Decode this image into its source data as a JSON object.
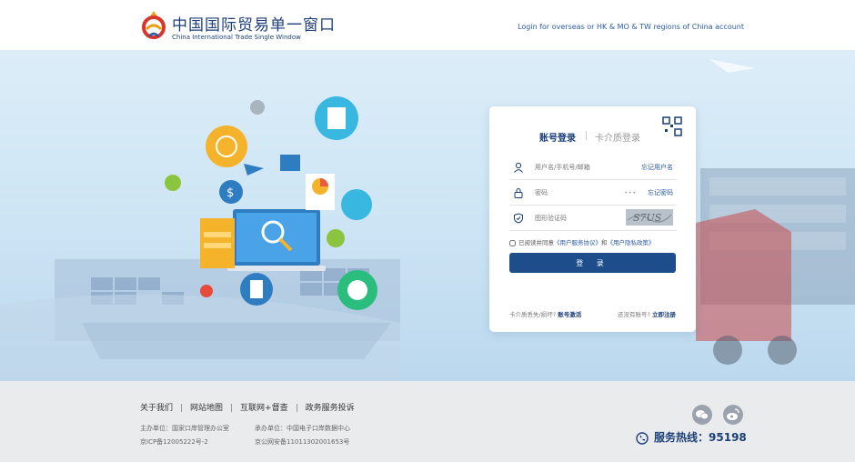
{
  "header": {
    "brand_cn": "中国国际贸易单一窗口",
    "brand_en": "China International Trade Single Window",
    "overseas_login": "Login for overseas or HK & MO & TW regions of China account"
  },
  "login": {
    "tabs": [
      "账号登录",
      "卡介质登录"
    ],
    "username_placeholder": "用户名/手机号/邮箱",
    "forgot_username": "忘记用户名",
    "password_placeholder": "密码",
    "forgot_password": "忘记密码",
    "captcha_placeholder": "图形验证码",
    "captcha_text": "S7US",
    "agree_prefix": "已阅读并同意",
    "agree_service": "《用户服务协议》",
    "agree_and": "和",
    "agree_privacy": "《用户隐私政策》",
    "login_button": "登 录",
    "card_lost_text": "卡介质丢失/损坏?",
    "card_activate": "账号激活",
    "no_account_text": "还没有账号?",
    "register": "立即注册"
  },
  "footer": {
    "links": [
      "关于我们",
      "网站地图",
      "互联网+督查",
      "政务服务投诉"
    ],
    "host": "主办单位：国家口岸管理办公室",
    "icp": "京ICP备12005222号-2",
    "operator": "承办单位：中国电子口岸数据中心",
    "police": "京公网安备11011302001653号",
    "hotline_label": "服务热线：",
    "hotline_number": "95198"
  },
  "colors": {
    "primary": "#1e4d8c",
    "brand": "#1c3f7a",
    "link": "#2a5aa8",
    "footer_bg": "#eaebed"
  }
}
